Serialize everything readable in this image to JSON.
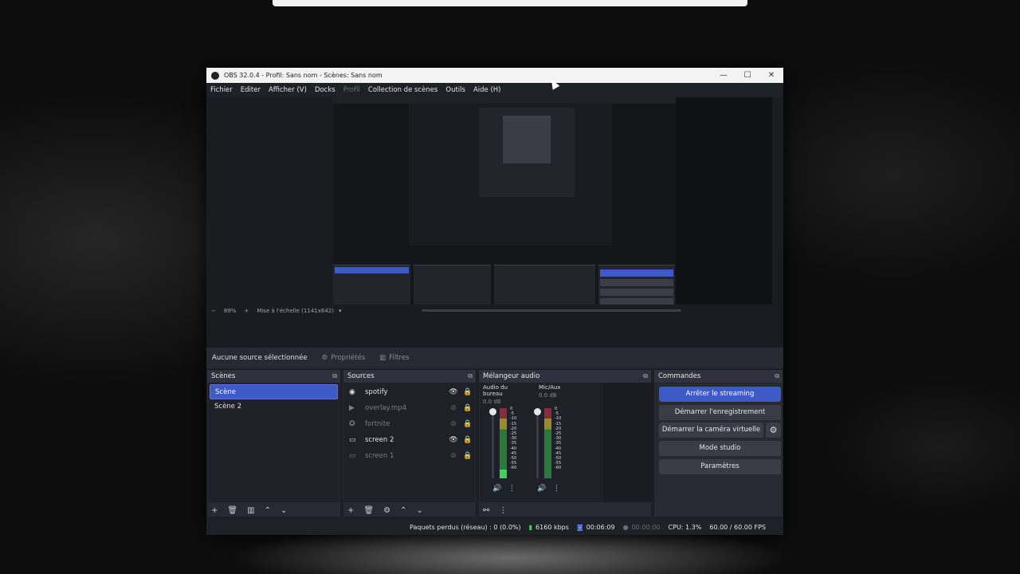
{
  "window": {
    "title": "OBS 32.0.4 - Profil: Sans nom - Scènes: Sans nom",
    "minimize": "—",
    "maximize": "☐",
    "close": "✕"
  },
  "menu": {
    "items": [
      "Fichier",
      "Editer",
      "Afficher (V)",
      "Docks",
      "Profil",
      "Collection de scènes",
      "Outils",
      "Aide (H)"
    ]
  },
  "zoom": {
    "minus": "−",
    "value": "89%",
    "plus": "+",
    "mode": "Mise à l'échelle (1141x642)"
  },
  "source_toolbar": {
    "no_selection": "Aucune source sélectionnée",
    "properties": "Propriétés",
    "filters": "Filtres"
  },
  "scenes": {
    "title": "Scènes",
    "items": [
      "Scène",
      "Scène 2"
    ],
    "selected_index": 0
  },
  "sources": {
    "title": "Sources",
    "items": [
      {
        "name": "spotify",
        "icon": "globe-icon",
        "visible": true
      },
      {
        "name": "overlay.mp4",
        "icon": "play-icon",
        "visible": false
      },
      {
        "name": "fortnite",
        "icon": "gamepad-icon",
        "visible": false
      },
      {
        "name": "screen 2",
        "icon": "monitor-icon",
        "visible": true
      },
      {
        "name": "screen 1",
        "icon": "monitor-icon",
        "visible": false
      }
    ]
  },
  "mixer": {
    "title": "Mélangeur audio",
    "channels": [
      {
        "name": "Audio du bureau",
        "db": "0.0 dB",
        "level": 0.12
      },
      {
        "name": "Mic/Aux",
        "db": "0.0 dB",
        "level": 0.0
      }
    ],
    "ticks": [
      "0",
      "-5",
      "-10",
      "-15",
      "-20",
      "-25",
      "-30",
      "-35",
      "-40",
      "-45",
      "-50",
      "-55",
      "-60"
    ]
  },
  "commands": {
    "title": "Commandes",
    "stop_streaming": "Arrêter le streaming",
    "start_recording": "Démarrer l'enregistrement",
    "start_virtual_cam": "Démarrer la caméra virtuelle",
    "studio_mode": "Mode studio",
    "settings": "Paramètres"
  },
  "status": {
    "dropped": "Paquets perdus (réseau) : 0 (0.0%)",
    "bitrate": "6160 kbps",
    "stream_time": "00:06:09",
    "rec_time": "00:00:00",
    "cpu": "CPU: 1.3%",
    "fps": "60.00 / 60.00 FPS"
  },
  "colors": {
    "accent": "#3e5ac7",
    "panel": "#272a33",
    "bg": "#1f2128",
    "meter_green": "#3fd160"
  }
}
